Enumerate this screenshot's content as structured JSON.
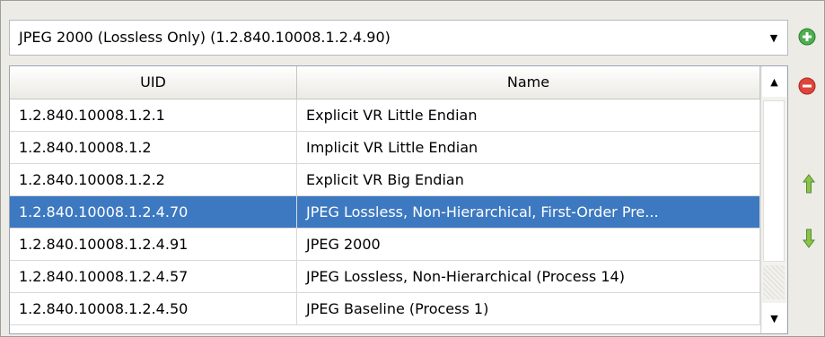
{
  "combo": {
    "selected": "JPEG 2000 (Lossless Only) (1.2.840.10008.1.2.4.90)",
    "arrow_icon": "dropdown-arrow-icon"
  },
  "table": {
    "headers": {
      "uid": "UID",
      "name": "Name"
    },
    "rows": [
      {
        "uid": "1.2.840.10008.1.2.1",
        "name": "Explicit VR Little Endian"
      },
      {
        "uid": "1.2.840.10008.1.2",
        "name": "Implicit VR Little Endian"
      },
      {
        "uid": "1.2.840.10008.1.2.2",
        "name": "Explicit VR Big Endian"
      },
      {
        "uid": "1.2.840.10008.1.2.4.70",
        "name": "JPEG Lossless, Non-Hierarchical, First-Order Pre..."
      },
      {
        "uid": "1.2.840.10008.1.2.4.91",
        "name": "JPEG 2000"
      },
      {
        "uid": "1.2.840.10008.1.2.4.57",
        "name": "JPEG Lossless, Non-Hierarchical (Process 14)"
      },
      {
        "uid": "1.2.840.10008.1.2.4.50",
        "name": "JPEG Baseline (Process 1)"
      }
    ],
    "selected_row": 3
  },
  "side_buttons": {
    "add_icon": "plus-circle-icon",
    "remove_icon": "minus-circle-icon",
    "up_icon": "arrow-up-icon",
    "down_icon": "arrow-down-icon"
  },
  "colors": {
    "selection": "#3d79c0",
    "add_green": "#4caf50",
    "remove_red": "#e0443a",
    "arrow_green": "#7cb342"
  }
}
